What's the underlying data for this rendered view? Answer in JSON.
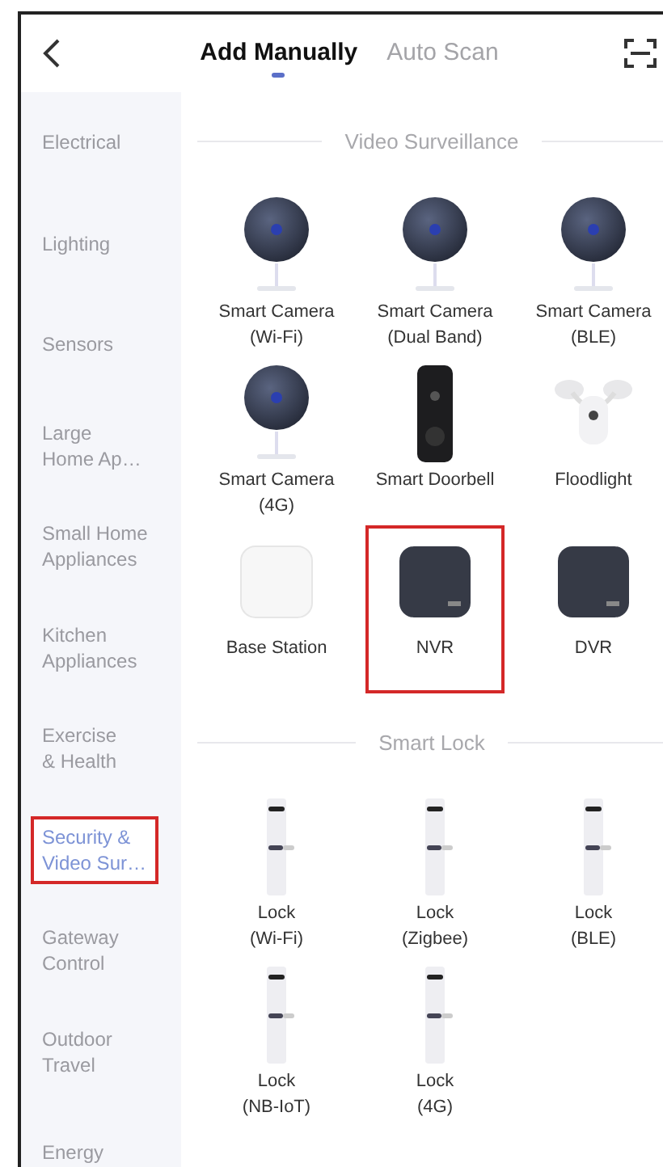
{
  "header": {
    "tabs": [
      {
        "label": "Add Manually",
        "selected": true
      },
      {
        "label": "Auto Scan",
        "selected": false
      }
    ]
  },
  "sidebar": {
    "items": [
      {
        "label": "Electrical",
        "selected": false,
        "highlighted": false
      },
      {
        "label": "Lighting",
        "selected": false,
        "highlighted": false
      },
      {
        "label": "Sensors",
        "selected": false,
        "highlighted": false
      },
      {
        "label": "Large\nHome Ap…",
        "selected": false,
        "highlighted": false
      },
      {
        "label": "Small Home\nAppliances",
        "selected": false,
        "highlighted": false
      },
      {
        "label": "Kitchen\nAppliances",
        "selected": false,
        "highlighted": false
      },
      {
        "label": "Exercise\n& Health",
        "selected": false,
        "highlighted": false
      },
      {
        "label": "Security &\nVideo Sur…",
        "selected": true,
        "highlighted": true
      },
      {
        "label": "Gateway\nControl",
        "selected": false,
        "highlighted": false
      },
      {
        "label": "Outdoor\nTravel",
        "selected": false,
        "highlighted": false
      },
      {
        "label": "Energy",
        "selected": false,
        "highlighted": false
      }
    ]
  },
  "sections": [
    {
      "title": "Video Surveillance",
      "devices": [
        {
          "name": "Smart Camera\n(Wi-Fi)",
          "kind": "camera",
          "highlighted": false
        },
        {
          "name": "Smart Camera\n(Dual Band)",
          "kind": "camera",
          "highlighted": false
        },
        {
          "name": "Smart Camera\n(BLE)",
          "kind": "camera",
          "highlighted": false
        },
        {
          "name": "Smart Camera\n(4G)",
          "kind": "camera",
          "highlighted": false
        },
        {
          "name": "Smart Doorbell",
          "kind": "doorbell",
          "highlighted": false
        },
        {
          "name": "Floodlight",
          "kind": "floodlight",
          "highlighted": false
        },
        {
          "name": "Base Station",
          "kind": "base",
          "highlighted": false
        },
        {
          "name": "NVR",
          "kind": "recorder",
          "highlighted": true
        },
        {
          "name": "DVR",
          "kind": "recorder",
          "highlighted": false
        }
      ]
    },
    {
      "title": "Smart Lock",
      "devices": [
        {
          "name": "Lock\n(Wi-Fi)",
          "kind": "lock",
          "highlighted": false
        },
        {
          "name": "Lock\n(Zigbee)",
          "kind": "lock",
          "highlighted": false
        },
        {
          "name": "Lock\n(BLE)",
          "kind": "lock",
          "highlighted": false
        },
        {
          "name": "Lock\n(NB-IoT)",
          "kind": "lock",
          "highlighted": false
        },
        {
          "name": "Lock\n(4G)",
          "kind": "lock",
          "highlighted": false
        }
      ]
    }
  ]
}
